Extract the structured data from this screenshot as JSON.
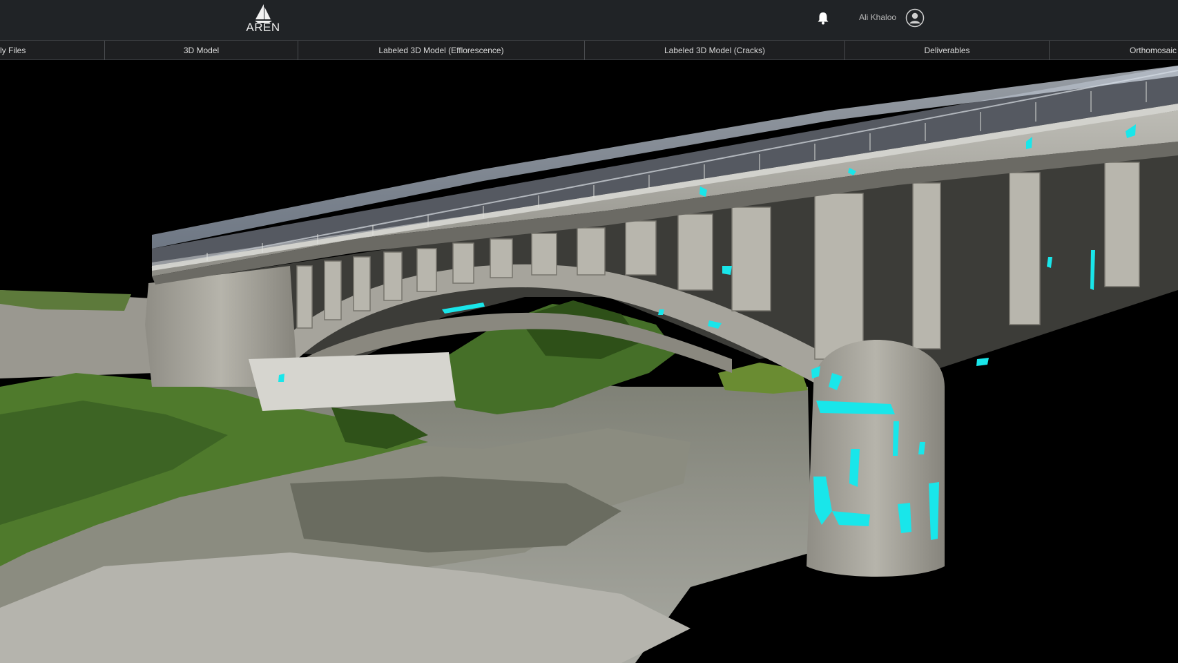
{
  "header": {
    "logo_text": "AREN",
    "user_name": "Ali Khaloo",
    "bell_icon": "bell-icon",
    "avatar_icon": "user-avatar-icon"
  },
  "tabs": [
    {
      "label": "ly Files"
    },
    {
      "label": "3D Model"
    },
    {
      "label": "Labeled 3D Model (Efflorescence)"
    },
    {
      "label": "Labeled 3D Model (Cracks)"
    },
    {
      "label": "Deliverables"
    },
    {
      "label": "Orthomosaic"
    }
  ],
  "colors": {
    "topbar": "#202326",
    "tabbar": "#1e1f21",
    "crack_label": "#19e6ea",
    "background": "#000000"
  }
}
